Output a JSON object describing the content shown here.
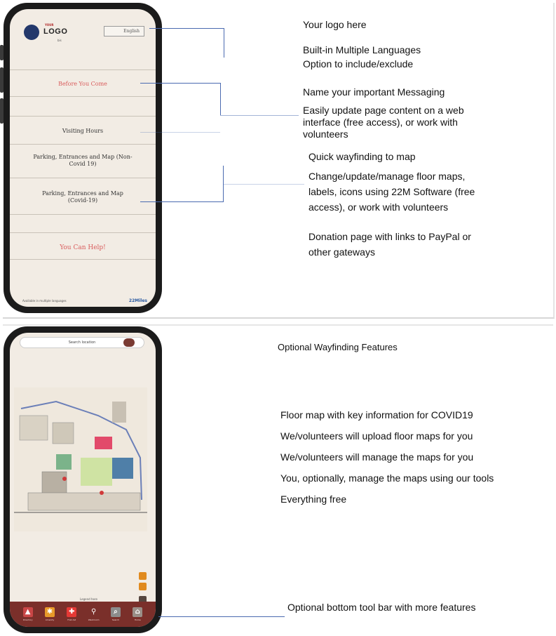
{
  "top_phone": {
    "logo": {
      "small": "YOUR",
      "text": "LOGO",
      "sub": "bis"
    },
    "language_button": "English",
    "menu": [
      {
        "label": "Before You Come",
        "color": "#d95c5c"
      },
      {
        "label": "Visiting Hours",
        "color": "#333333"
      },
      {
        "label": "Parking, Entrances and Map (Non-Covid 19)",
        "color": "#333333"
      },
      {
        "label": "Parking, Entrances and Map (Covid-19)",
        "color": "#333333"
      },
      {
        "label": "You Can Help!",
        "color": "#d95c5c"
      }
    ],
    "footer": "Available in multiple languages",
    "footer_brand": "22Miles"
  },
  "annotations_top": {
    "logo": "Your logo here",
    "languages_line1": "Built-in Multiple Languages",
    "languages_line2": "Option to include/exclude",
    "messaging_title": "Name your important Messaging",
    "messaging_l1": "Easily update page content on a web",
    "messaging_l2": "interface (free access), or work with",
    "messaging_l3": "volunteers",
    "wayfinding_title": "Quick wayfinding to map",
    "floor_l1": "Change/update/manage floor maps,",
    "floor_l2": "labels, icons using 22M Software (free",
    "floor_l3": "access), or work with volunteers",
    "donation_l1": "Donation page with links to PayPal or",
    "donation_l2": "other gateways"
  },
  "bottom_phone": {
    "search_placeholder": "Search location",
    "map_caption": "Legend here",
    "toolbar": [
      {
        "label": "Directory",
        "icon": "building-icon"
      },
      {
        "label": "Amenity",
        "icon": "star-icon"
      },
      {
        "label": "First Aid",
        "icon": "cross-icon"
      },
      {
        "label": "Washroom",
        "icon": "washroom-icon"
      },
      {
        "label": "Search",
        "icon": "search-icon"
      },
      {
        "label": "Home",
        "icon": "home-icon"
      }
    ]
  },
  "annotations_bottom": {
    "title": "Optional Wayfinding Features",
    "f1": "Floor map with key information for COVID19",
    "f2": "We/volunteers will upload floor maps for you",
    "f3": "We/volunteers will manage the maps for you",
    "f4": "You, optionally, manage the maps using our tools",
    "f5": "Everything free",
    "toolbar_note": "Optional bottom tool bar with more features"
  },
  "colors": {
    "accent": "#4a6ab0",
    "brand_red": "#d95c5c",
    "toolbar": "#7a2f2a"
  }
}
